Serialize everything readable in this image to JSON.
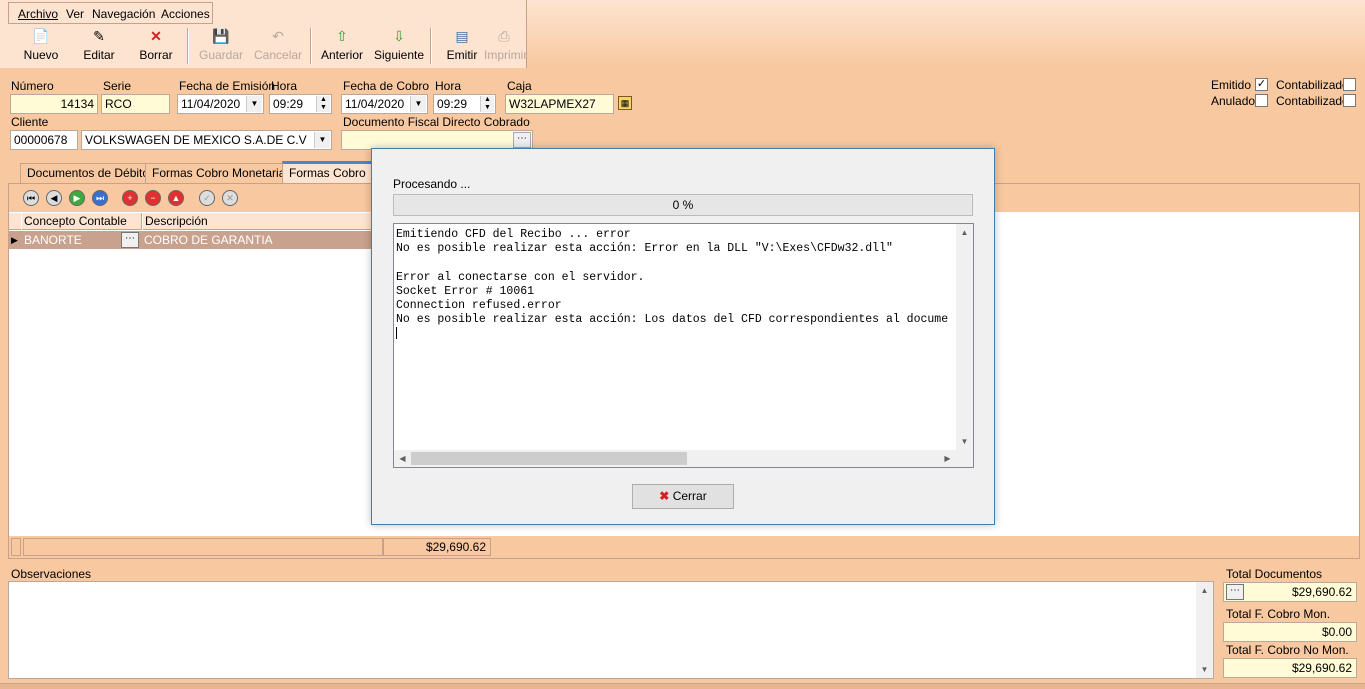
{
  "menu": [
    "Archivo",
    "Ver",
    "Navegación",
    "Acciones"
  ],
  "toolbar": [
    {
      "label": "Nuevo",
      "icon": "new-doc-icon",
      "enabled": true
    },
    {
      "label": "Editar",
      "icon": "edit-icon",
      "enabled": true
    },
    {
      "label": "Borrar",
      "icon": "delete-icon",
      "enabled": true
    },
    {
      "label": "Guardar",
      "icon": "save-icon",
      "enabled": false
    },
    {
      "label": "Cancelar",
      "icon": "cancel-icon",
      "enabled": false
    },
    {
      "label": "Anterior",
      "icon": "arrow-up-icon",
      "enabled": true
    },
    {
      "label": "Siguiente",
      "icon": "arrow-down-icon",
      "enabled": true
    },
    {
      "label": "Emitir",
      "icon": "emit-icon",
      "enabled": true
    },
    {
      "label": "Imprimir",
      "icon": "printer-icon",
      "enabled": false
    }
  ],
  "form": {
    "numero_label": "Número",
    "numero": "14134",
    "serie_label": "Serie",
    "serie": "RCO",
    "fecha_emision_label": "Fecha de Emisión",
    "fecha_emision": "11/04/2020",
    "hora_label": "Hora",
    "hora_emision": "09:29",
    "fecha_cobro_label": "Fecha de Cobro",
    "fecha_cobro": "11/04/2020",
    "hora_cobro": "09:29",
    "caja_label": "Caja",
    "caja": "W32LAPMEX27",
    "cliente_label": "Cliente",
    "cliente_id": "00000678",
    "cliente_nombre": "VOLKSWAGEN DE MEXICO S.A.DE C.V",
    "doc_fiscal_label": "Documento Fiscal Directo Cobrado",
    "doc_fiscal": "",
    "emitido_label": "Emitido",
    "emitido": true,
    "anulado_label": "Anulado",
    "anulado": false,
    "contabilizado_label": "Contabilizado",
    "contabilizado1": false,
    "contabilizado2": false
  },
  "tabs": [
    "Documentos de Débito",
    "Formas Cobro Monetarias",
    "Formas Cobro No"
  ],
  "grid": {
    "headers": [
      "Concepto Contable",
      "Descripción"
    ],
    "rows": [
      {
        "concepto": "BANORTE",
        "descripcion": "COBRO DE GARANTIA"
      }
    ],
    "total": "$29,690.62"
  },
  "observaciones_label": "Observaciones",
  "totals": {
    "docs_label": "Total Documentos",
    "docs": "$29,690.62",
    "mon_label": "Total F. Cobro Mon.",
    "mon": "$0.00",
    "nomon_label": "Total F. Cobro No Mon.",
    "nomon": "$29,690.62"
  },
  "dialog": {
    "title": "Procesando ...",
    "progress": "0 %",
    "progress_value": 0,
    "log": "Emitiendo CFD del Recibo ... error\nNo es posible realizar esta acción: Error en la DLL \"V:\\Exes\\CFDw32.dll\"\n\nError al conectarse con el servidor.\nSocket Error # 10061\nConnection refused.error\nNo es posible realizar esta acción: Los datos del CFD correspondientes al docume",
    "close_label": "Cerrar"
  },
  "colors": {
    "background": "#f8c8a0",
    "field": "#fffbd7",
    "accent": "#4a86c8"
  }
}
